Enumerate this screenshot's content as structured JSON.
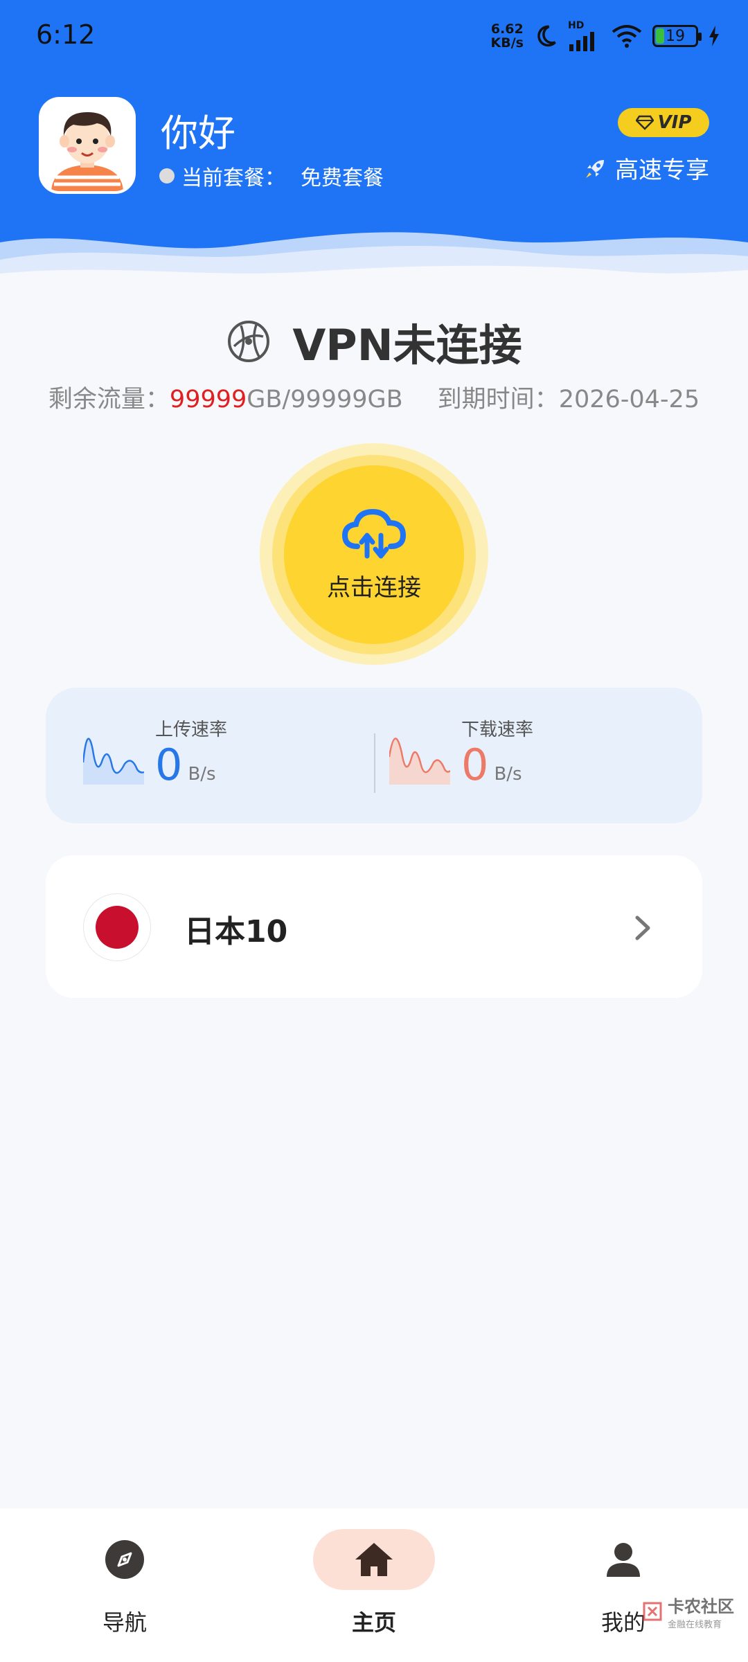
{
  "status_bar": {
    "time": "6:12",
    "net_speed_value": "6.62",
    "net_speed_unit": "KB/s",
    "hd_label": "HD",
    "battery": "19"
  },
  "profile": {
    "greeting": "你好",
    "plan_label": "当前套餐：",
    "plan_value": "免费套餐",
    "vip_label": "VIP",
    "speed_tag": "高速专享"
  },
  "vpn": {
    "status": "VPN未连接",
    "traffic_label": "剩余流量：",
    "traffic_remaining": "99999",
    "traffic_total": "GB/99999GB",
    "expiry_label": "到期时间：",
    "expiry_date": "2026-04-25",
    "connect_label": "点击连接"
  },
  "speed": {
    "upload_label": "上传速率",
    "upload_value": "0",
    "upload_unit": "B/s",
    "download_label": "下载速率",
    "download_value": "0",
    "download_unit": "B/s"
  },
  "server": {
    "name": "日本10",
    "flag_icon": "japan-flag-icon"
  },
  "nav": {
    "items": [
      {
        "label": "导航",
        "icon": "compass-icon"
      },
      {
        "label": "主页",
        "icon": "home-icon"
      },
      {
        "label": "我的",
        "icon": "user-icon"
      }
    ]
  },
  "watermark": {
    "title": "卡农社区",
    "subtitle": "金融在线教育"
  },
  "colors": {
    "header_blue": "#1f74f6",
    "connect_yellow": "#fdd430",
    "upload_blue": "#2677e8",
    "download_red": "#ec7a67",
    "traffic_red": "#e02020",
    "nav_active_bg": "#fde0d5"
  }
}
